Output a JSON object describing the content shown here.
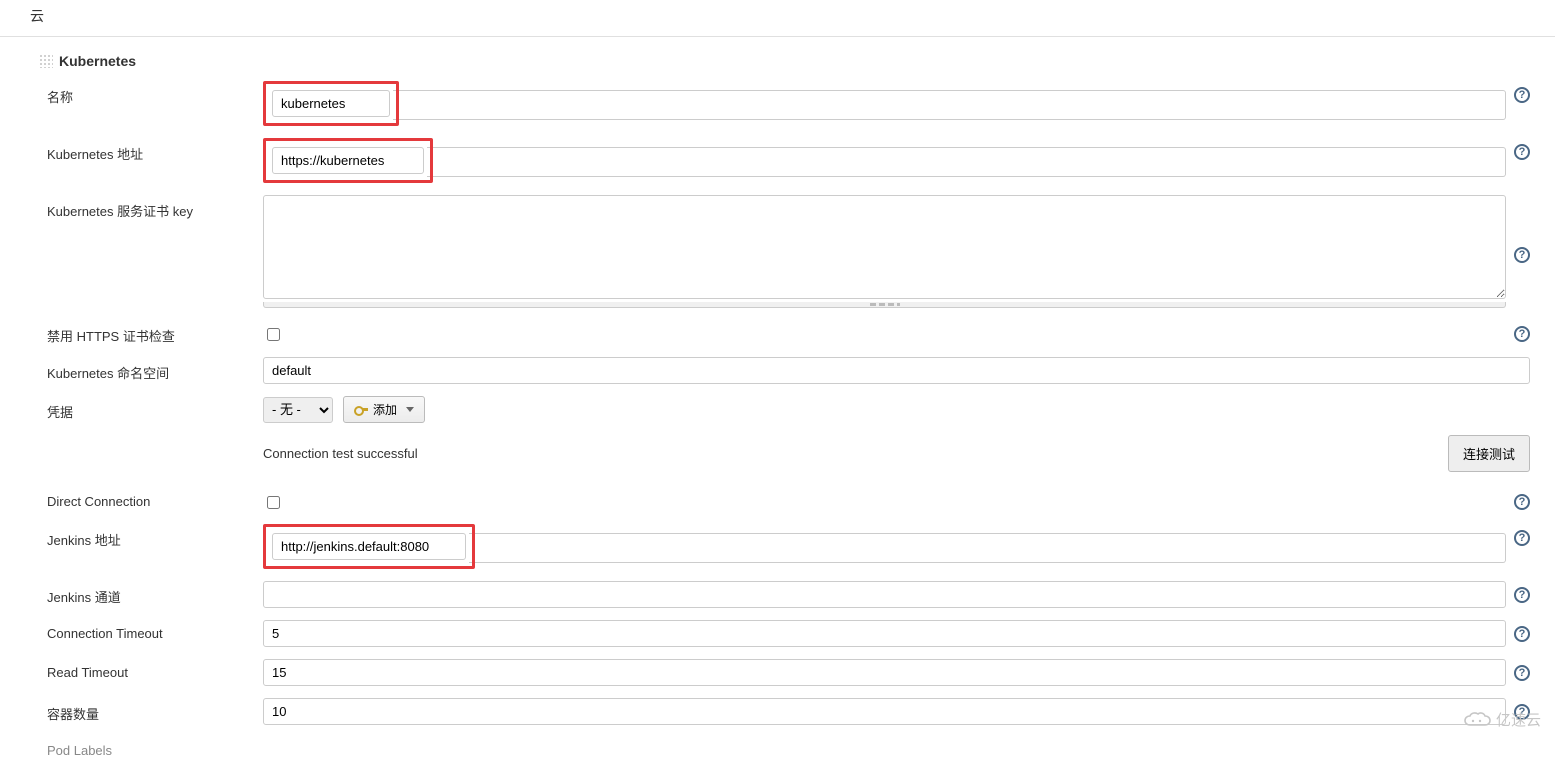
{
  "page_header": "云",
  "section_title": "Kubernetes",
  "labels": {
    "name": "名称",
    "kube_url": "Kubernetes 地址",
    "cert_key": "Kubernetes 服务证书 key",
    "disable_https": "禁用 HTTPS 证书检查",
    "namespace": "Kubernetes 命名空间",
    "credentials": "凭据",
    "direct_conn": "Direct Connection",
    "jenkins_url": "Jenkins 地址",
    "jenkins_tunnel": "Jenkins 通道",
    "conn_timeout": "Connection Timeout",
    "read_timeout": "Read Timeout",
    "container_count": "容器数量",
    "pod_labels": "Pod Labels"
  },
  "values": {
    "name": "kubernetes",
    "kube_url": "https://kubernetes",
    "cert_key": "",
    "disable_https_checked": false,
    "namespace": "default",
    "credentials_selected": "- 无 -",
    "add_button": "添加",
    "conn_test_msg": "Connection test successful",
    "conn_test_btn": "连接测试",
    "direct_conn_checked": false,
    "jenkins_url": "http://jenkins.default:8080",
    "jenkins_tunnel": "",
    "conn_timeout": "5",
    "read_timeout": "15",
    "container_count": "10"
  },
  "watermark": "亿速云"
}
